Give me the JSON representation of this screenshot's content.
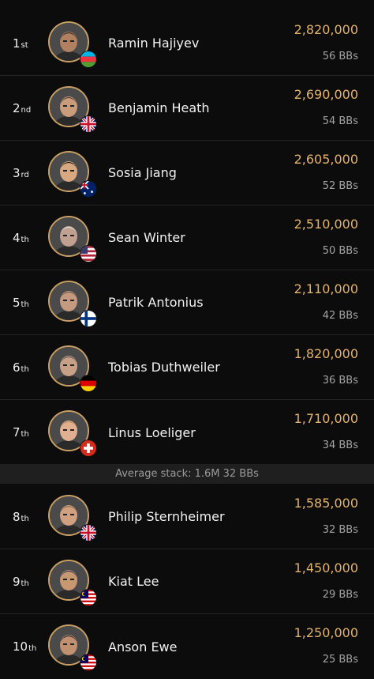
{
  "players": [
    {
      "pos": "1",
      "suf": "st",
      "name": "Ramin Hajiyev",
      "chips": "2,820,000",
      "bbs": "56 BBs",
      "flag": "azerbaijan",
      "skin": "#b08060",
      "hair": "#222"
    },
    {
      "pos": "2",
      "suf": "nd",
      "name": "Benjamin Heath",
      "chips": "2,690,000",
      "bbs": "54 BBs",
      "flag": "uk",
      "skin": "#c89c7c",
      "hair": "#3a2a1c"
    },
    {
      "pos": "3",
      "suf": "rd",
      "name": "Sosia Jiang",
      "chips": "2,605,000",
      "bbs": "52 BBs",
      "flag": "australia",
      "skin": "#d8a880",
      "hair": "#151515"
    },
    {
      "pos": "4",
      "suf": "th",
      "name": "Sean Winter",
      "chips": "2,510,000",
      "bbs": "50 BBs",
      "flag": "usa",
      "skin": "#c0a090",
      "hair": "#e0e0e0"
    },
    {
      "pos": "5",
      "suf": "th",
      "name": "Patrik Antonius",
      "chips": "2,110,000",
      "bbs": "42 BBs",
      "flag": "finland",
      "skin": "#c49a80",
      "hair": "#6a5640"
    },
    {
      "pos": "6",
      "suf": "th",
      "name": "Tobias Duthweiler",
      "chips": "1,820,000",
      "bbs": "36 BBs",
      "flag": "germany",
      "skin": "#c8a088",
      "hair": "#555"
    },
    {
      "pos": "7",
      "suf": "th",
      "name": "Linus Loeliger",
      "chips": "1,710,000",
      "bbs": "34 BBs",
      "flag": "switzerland",
      "skin": "#e0b090",
      "hair": "#c08a50"
    },
    {
      "pos": "8",
      "suf": "th",
      "name": "Philip Sternheimer",
      "chips": "1,585,000",
      "bbs": "32 BBs",
      "flag": "uk",
      "skin": "#d0a080",
      "hair": "#8a6a40"
    },
    {
      "pos": "9",
      "suf": "th",
      "name": "Kiat Lee",
      "chips": "1,450,000",
      "bbs": "29 BBs",
      "flag": "malaysia",
      "skin": "#c89870",
      "hair": "#1a2a5a"
    },
    {
      "pos": "10",
      "suf": "th",
      "name": "Anson Ewe",
      "chips": "1,250,000",
      "bbs": "25 BBs",
      "flag": "malaysia",
      "skin": "#c09070",
      "hair": "#1a1a1a"
    }
  ],
  "average": {
    "label": "Average stack: 1.6M 32 BBs"
  },
  "colors": {
    "accent": "#c9a063",
    "chips": "#e2b36a",
    "background": "#0c0c0c"
  }
}
